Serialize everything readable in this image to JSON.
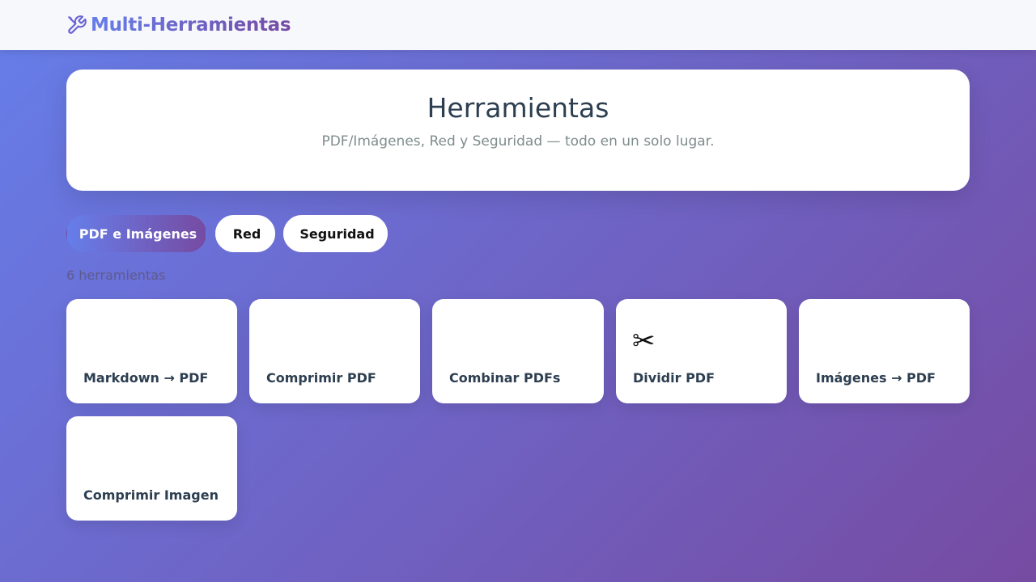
{
  "app": {
    "title": "Multi-Herramientas",
    "brand_icon": "tools-icon"
  },
  "hero": {
    "title": "Herramientas",
    "subtitle": "PDF/Imágenes, Red y Seguridad — todo en un solo lugar."
  },
  "tabs": [
    {
      "label": "PDF e Imágenes",
      "glyph": "",
      "icon": "missing-glyph-icon",
      "active": true
    },
    {
      "label": "Red",
      "glyph": "",
      "icon": "missing-glyph-icon",
      "active": false
    },
    {
      "label": "Seguridad",
      "glyph": "",
      "icon": "missing-glyph-icon",
      "active": false
    }
  ],
  "count_text": "6 herramientas",
  "tools": [
    {
      "label": "Markdown → PDF",
      "glyph": "",
      "icon": "missing-glyph-icon"
    },
    {
      "label": "Comprimir PDF",
      "glyph": "",
      "icon": "missing-glyph-icon"
    },
    {
      "label": "Combinar PDFs",
      "glyph": "",
      "icon": "missing-glyph-icon"
    },
    {
      "label": "Dividir PDF",
      "glyph": "✂",
      "icon": "scissors-icon"
    },
    {
      "label": "Imágenes → PDF",
      "glyph": "",
      "icon": "missing-glyph-icon"
    },
    {
      "label": "Comprimir Imagen",
      "glyph": "",
      "icon": "missing-glyph-icon"
    }
  ],
  "colors": {
    "gradient_start": "#667eea",
    "gradient_end": "#764ba2",
    "text_dark": "#2c3e50",
    "text_muted": "#7f8c8d"
  }
}
